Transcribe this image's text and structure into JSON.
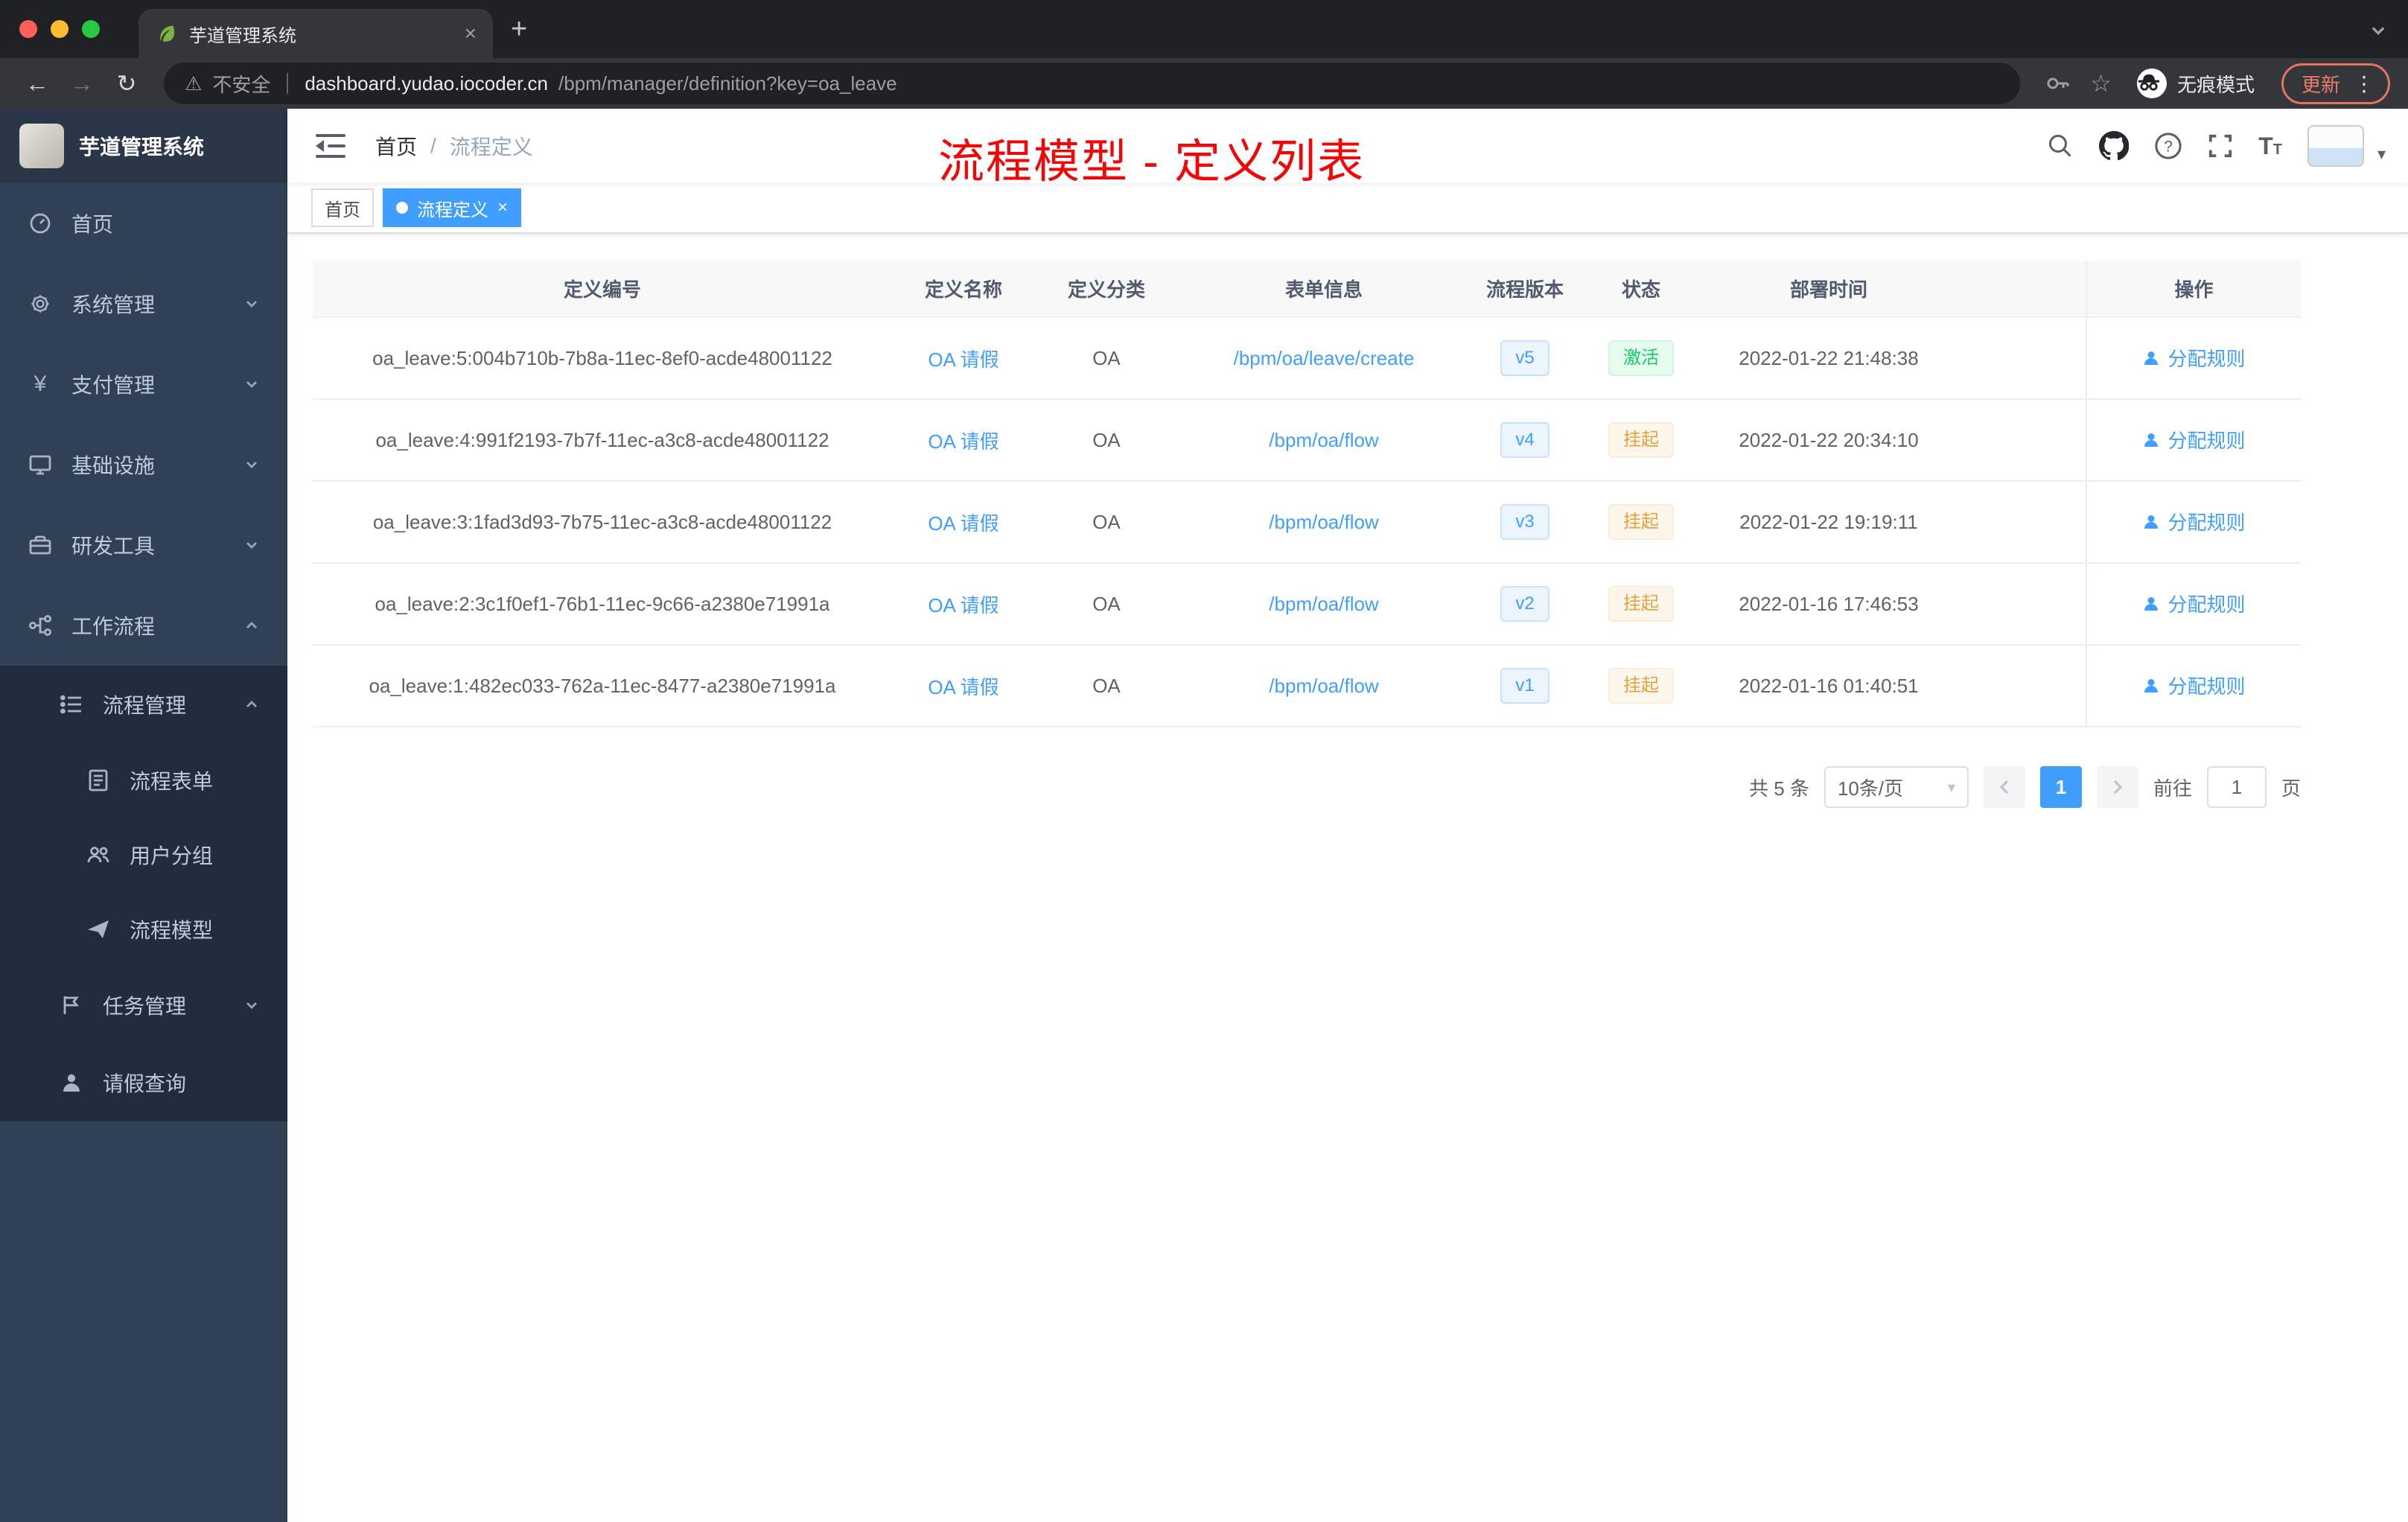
{
  "browser": {
    "tab_title": "芋道管理系统",
    "security_label": "不安全",
    "url_host": "dashboard.yudao.iocoder.cn",
    "url_path": "/bpm/manager/definition?key=oa_leave",
    "incognito_label": "无痕模式",
    "update_label": "更新"
  },
  "icons": {
    "back": "←",
    "forward": "→",
    "reload": "↻",
    "warning": "⚠",
    "star": "☆",
    "more": "⋮",
    "close": "×",
    "new_tab": "+",
    "caret_down": "▾",
    "font_big": "T",
    "font_small": "T"
  },
  "sidebar": {
    "logo_title": "芋道管理系统",
    "items": [
      {
        "label": "首页"
      },
      {
        "label": "系统管理"
      },
      {
        "label": "支付管理"
      },
      {
        "label": "基础设施"
      },
      {
        "label": "研发工具"
      },
      {
        "label": "工作流程"
      },
      {
        "label": "流程管理"
      },
      {
        "label": "流程表单"
      },
      {
        "label": "用户分组"
      },
      {
        "label": "流程模型"
      },
      {
        "label": "任务管理"
      },
      {
        "label": "请假查询"
      }
    ]
  },
  "header": {
    "breadcrumb": [
      "首页",
      "流程定义"
    ],
    "breadcrumb_separator": "/",
    "annotation": "流程模型 - 定义列表"
  },
  "tags": [
    {
      "label": "首页"
    },
    {
      "label": "流程定义"
    }
  ],
  "table": {
    "columns": [
      "定义编号",
      "定义名称",
      "定义分类",
      "表单信息",
      "流程版本",
      "状态",
      "部署时间",
      "操作"
    ],
    "action_label": "分配规则",
    "rows": [
      {
        "id": "oa_leave:5:004b710b-7b8a-11ec-8ef0-acde48001122",
        "name": "OA 请假",
        "category": "OA",
        "form": "/bpm/oa/leave/create",
        "version": "v5",
        "status": "激活",
        "status_type": "success",
        "time": "2022-01-22 21:48:38"
      },
      {
        "id": "oa_leave:4:991f2193-7b7f-11ec-a3c8-acde48001122",
        "name": "OA 请假",
        "category": "OA",
        "form": "/bpm/oa/flow",
        "version": "v4",
        "status": "挂起",
        "status_type": "warning",
        "time": "2022-01-22 20:34:10"
      },
      {
        "id": "oa_leave:3:1fad3d93-7b75-11ec-a3c8-acde48001122",
        "name": "OA 请假",
        "category": "OA",
        "form": "/bpm/oa/flow",
        "version": "v3",
        "status": "挂起",
        "status_type": "warning",
        "time": "2022-01-22 19:19:11"
      },
      {
        "id": "oa_leave:2:3c1f0ef1-76b1-11ec-9c66-a2380e71991a",
        "name": "OA 请假",
        "category": "OA",
        "form": "/bpm/oa/flow",
        "version": "v2",
        "status": "挂起",
        "status_type": "warning",
        "time": "2022-01-16 17:46:53"
      },
      {
        "id": "oa_leave:1:482ec033-762a-11ec-8477-a2380e71991a",
        "name": "OA 请假",
        "category": "OA",
        "form": "/bpm/oa/flow",
        "version": "v1",
        "status": "挂起",
        "status_type": "warning",
        "time": "2022-01-16 01:40:51"
      }
    ]
  },
  "pagination": {
    "total": "共 5 条",
    "page_size": "10条/页",
    "current_page": "1",
    "goto_prefix": "前往",
    "goto_value": "1",
    "goto_suffix": "页"
  },
  "colors": {
    "accent": "#409eff",
    "sidebar_bg": "#304156",
    "submenu_bg": "#1f2d3d",
    "success_text": "#13ce66",
    "warning_text": "#e6a23c",
    "annotation_red": "#f40606",
    "update_orange": "#e5735f",
    "traffic_close": "#ff5f57",
    "traffic_min": "#febc2e",
    "traffic_zoom": "#28c840"
  }
}
